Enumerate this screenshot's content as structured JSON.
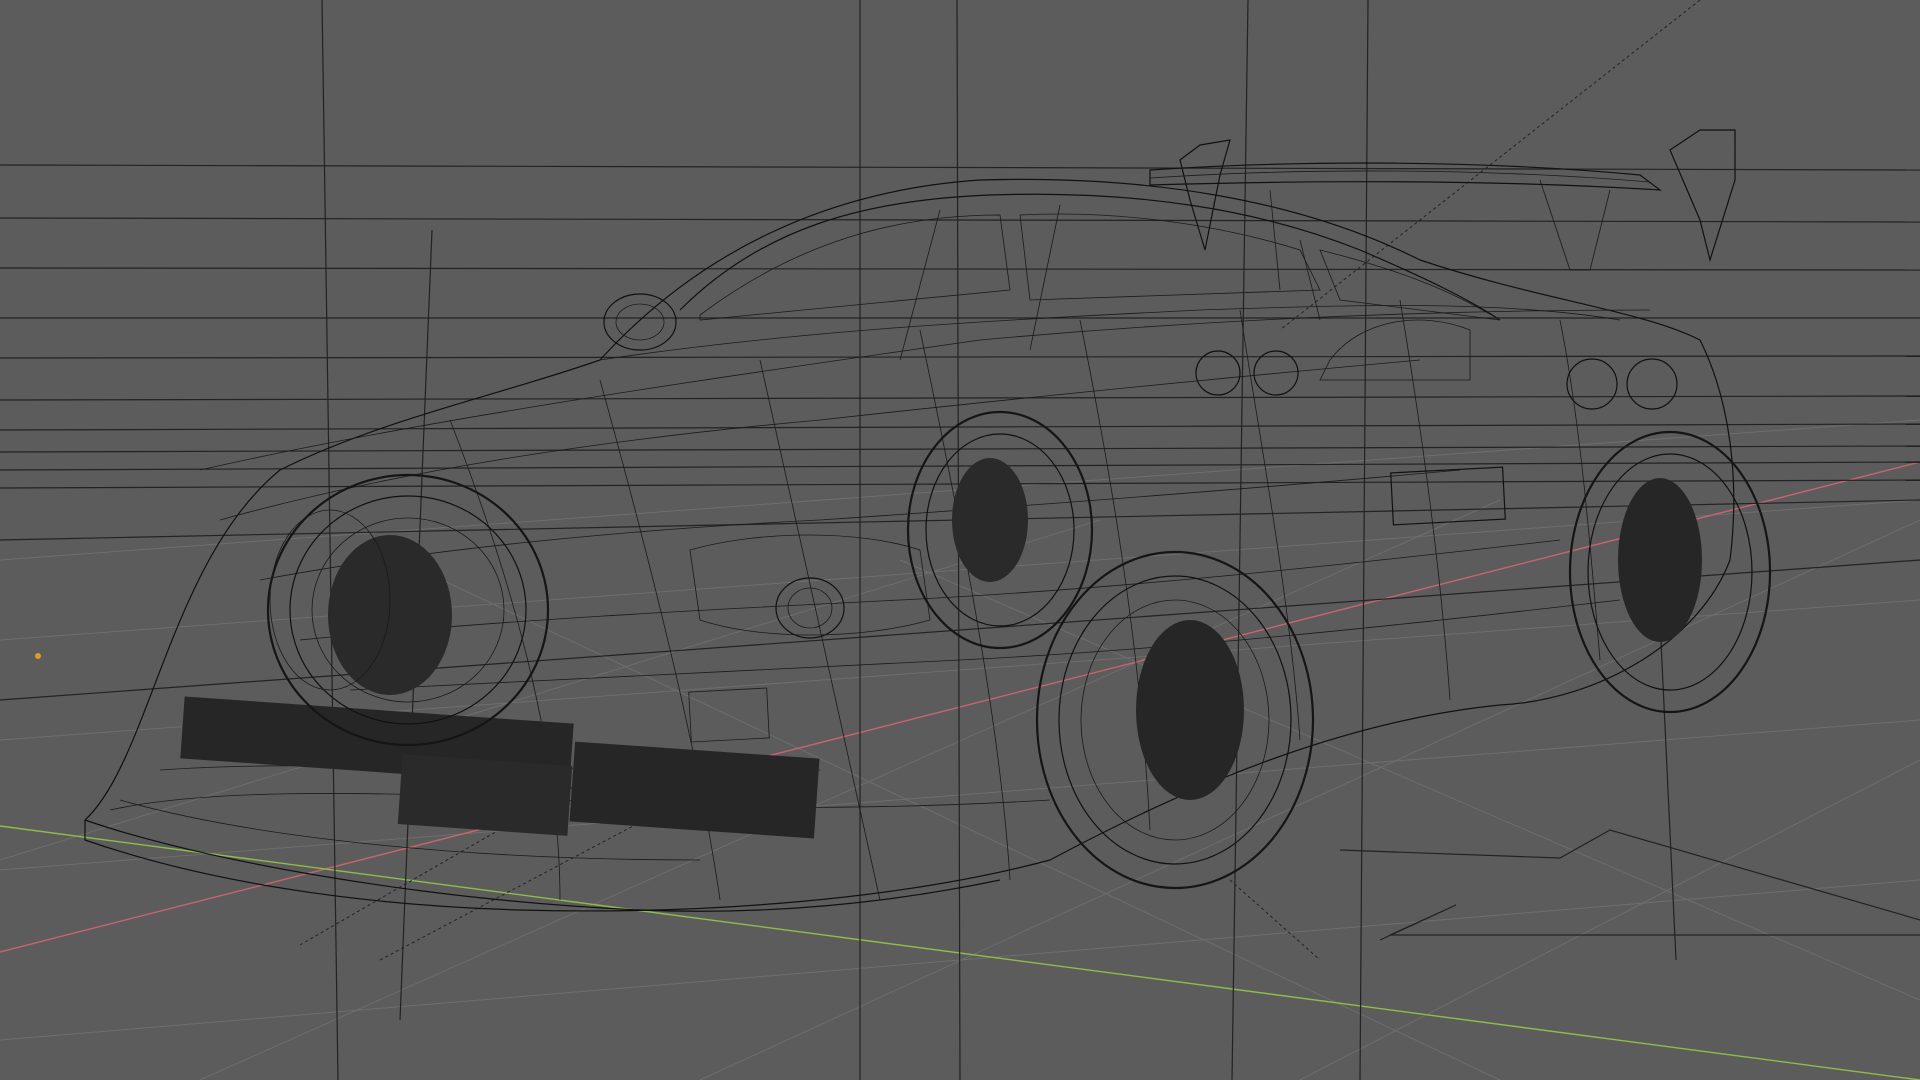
{
  "viewport": {
    "mode": "wireframe",
    "background_color": "#5c5c5c",
    "wire_color": "#111111",
    "grid_color": "#6e6e6e",
    "x_axis_color": "#c86470",
    "y_axis_color": "#8fbc4a",
    "origin_marker_color": "#e09a2a"
  },
  "scene": {
    "object_name": "car-wireframe-model",
    "light_markers": 1
  }
}
